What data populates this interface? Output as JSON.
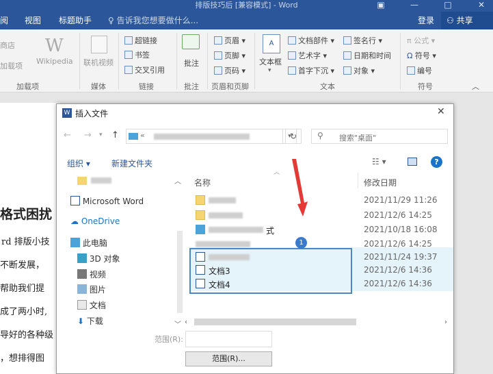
{
  "window": {
    "title": "排版技巧后 [兼容模式] - Word",
    "accent": "#2b579a"
  },
  "ribbon_tabs": [
    "阅",
    "视图",
    "标题助手"
  ],
  "tell_me": "告诉我您想要做什么...",
  "login": "登录",
  "share": "共享",
  "ribbon": {
    "addins_store": "商店",
    "addins_my": "加载项",
    "wikipedia": "Wikipedia",
    "online_video": "联机视频",
    "hyperlink": "超链接",
    "bookmark": "书签",
    "crossref": "交叉引用",
    "comment": "批注",
    "header": "页眉",
    "footer": "页脚",
    "pagenum": "页码",
    "textbox": "文本框",
    "quickparts": "文档部件",
    "wordart": "艺术字",
    "dropcap": "首字下沉",
    "signature": "签名行",
    "datetime": "日期和时间",
    "object": "对象",
    "equation": "公式",
    "symbol": "符号",
    "number": "编号",
    "groups": {
      "addins": "加载项",
      "media": "媒体",
      "links": "链接",
      "comments": "批注",
      "headerfooter": "页眉和页脚",
      "text": "文本",
      "symbols": "符号"
    }
  },
  "document": {
    "heading": "格式困扰",
    "lines": [
      "rd 排版小技",
      "不断发展，",
      "帮助我们提",
      "成了两小时,",
      "导好的各种级",
      "，想排得图"
    ]
  },
  "dialog": {
    "title": "插入文件",
    "search_placeholder": "搜索\"桌面\"",
    "organize": "组织",
    "new_folder": "新建文件夹",
    "col_name": "名称",
    "col_date": "修改日期",
    "nav_items": [
      {
        "label": "Microsoft Word"
      },
      {
        "label": "OneDrive"
      },
      {
        "label": "此电脑"
      },
      {
        "label": "3D 对象"
      },
      {
        "label": "视频"
      },
      {
        "label": "图片"
      },
      {
        "label": "文档"
      },
      {
        "label": "下载"
      }
    ],
    "files": [
      {
        "name": "",
        "date": "2021/11/29 11:26"
      },
      {
        "name": "",
        "date": "2021/12/6 14:25"
      },
      {
        "name": "式",
        "date": "2021/10/18 16:08"
      },
      {
        "name": "",
        "date": "2021/12/6 14:25"
      },
      {
        "name": "",
        "date": "2021/11/24 19:37"
      },
      {
        "name": "文档3",
        "date": "2021/12/6 14:36"
      },
      {
        "name": "文档4",
        "date": "2021/12/6 14:36"
      }
    ],
    "badge": "1",
    "range_label": "范围(R):",
    "range_button": "范围(R)..."
  }
}
